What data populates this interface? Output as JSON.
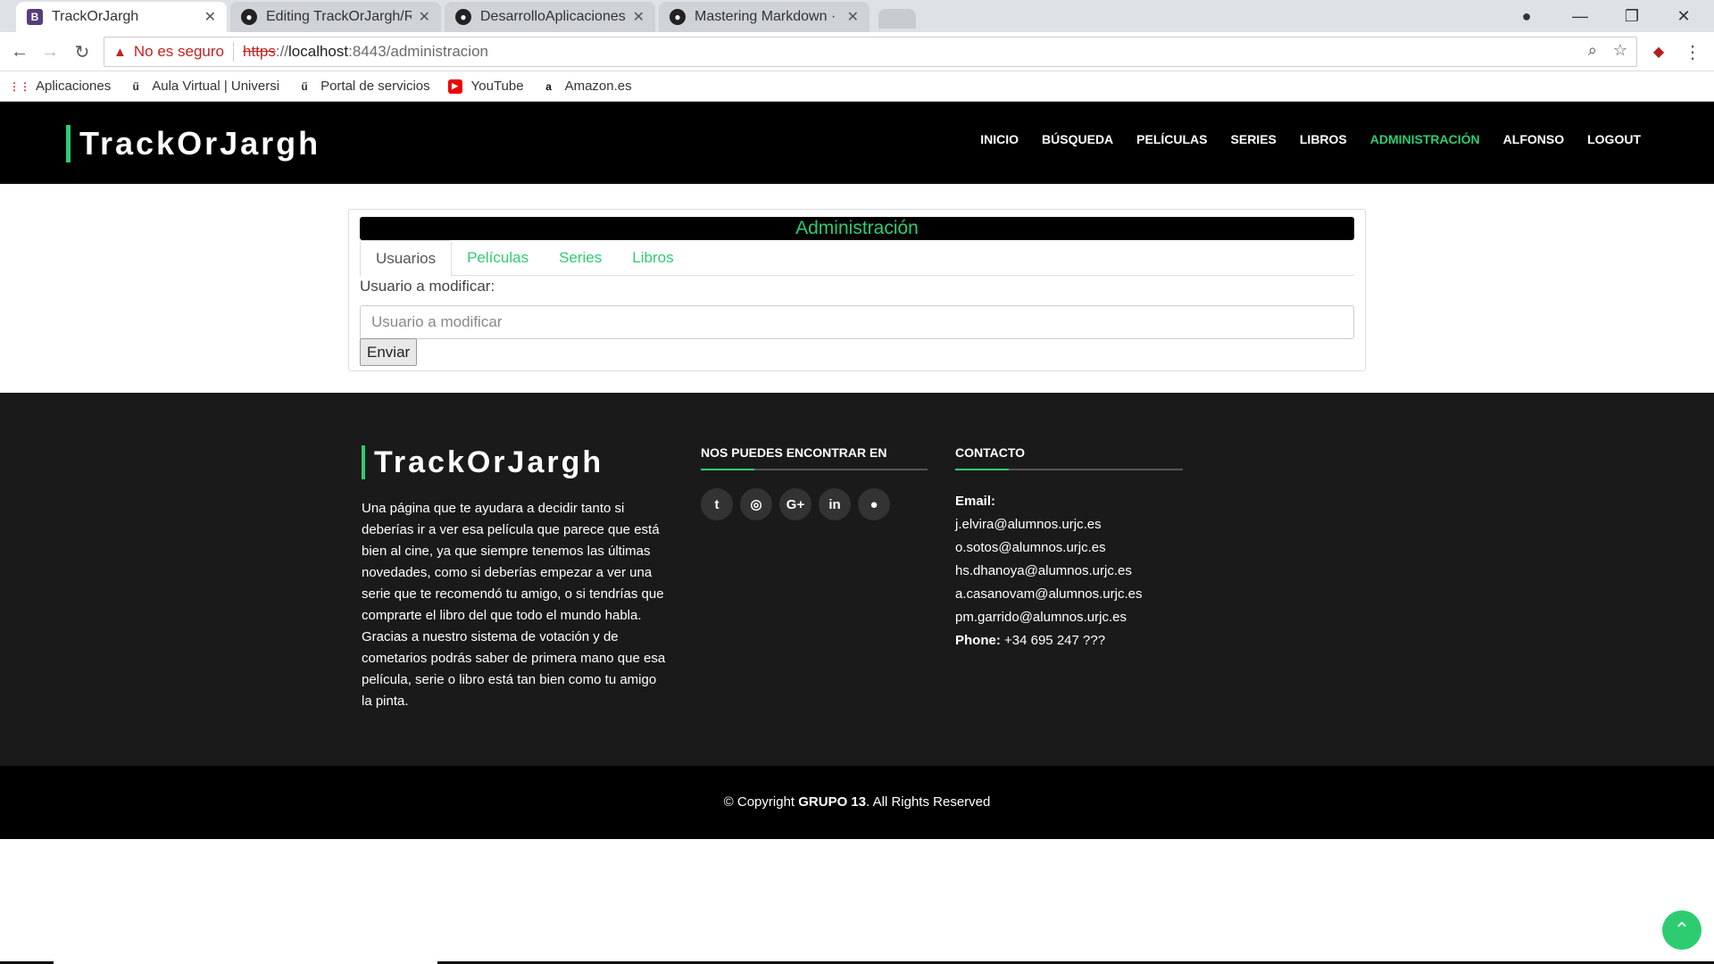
{
  "browser": {
    "tabs": [
      {
        "title": "TrackOrJargh",
        "icon": "bootstrap-icon",
        "active": true
      },
      {
        "title": "Editing TrackOrJargh/RE",
        "icon": "github-icon",
        "active": false
      },
      {
        "title": "DesarrolloAplicacionesW",
        "icon": "github-icon",
        "active": false
      },
      {
        "title": "Mastering Markdown · G",
        "icon": "github-icon",
        "active": false
      }
    ],
    "security_label": "No es seguro",
    "url_scheme": "https",
    "url_sep": "://",
    "url_host": "localhost",
    "url_path": ":8443/administracion",
    "bookmarks": [
      {
        "label": "Aplicaciones",
        "icon": "apps-grid-icon"
      },
      {
        "label": "Aula Virtual | Universi",
        "icon": "urjc-icon"
      },
      {
        "label": "Portal de servicios",
        "icon": "urjc-icon"
      },
      {
        "label": "YouTube",
        "icon": "youtube-icon"
      },
      {
        "label": "Amazon.es",
        "icon": "amazon-icon"
      }
    ]
  },
  "site": {
    "brand": "TrackOrJargh",
    "nav": [
      {
        "label": "INICIO",
        "active": false
      },
      {
        "label": "BÚSQUEDA",
        "active": false
      },
      {
        "label": "PELÍCULAS",
        "active": false
      },
      {
        "label": "SERIES",
        "active": false
      },
      {
        "label": "LIBROS",
        "active": false
      },
      {
        "label": "ADMINISTRACIÓN",
        "active": true
      },
      {
        "label": "ALFONSO",
        "active": false
      },
      {
        "label": "LOGOUT",
        "active": false
      }
    ],
    "accent_color": "#2ecc71"
  },
  "admin": {
    "title": "Administración",
    "tabs": [
      {
        "label": "Usuarios",
        "active": true
      },
      {
        "label": "Películas",
        "active": false
      },
      {
        "label": "Series",
        "active": false
      },
      {
        "label": "Libros",
        "active": false
      }
    ],
    "field_label": "Usuario a modificar:",
    "field_placeholder": "Usuario a modificar",
    "submit_label": "Enviar"
  },
  "footer": {
    "brand": "TrackOrJargh",
    "description": "Una página que te ayudara a decidir tanto si deberías ir a ver esa película que parece que está bien al cine, ya que siempre tenemos las últimas novedades, como si deberías empezar a ver una serie que te recomendó tu amigo, o si tendrías que comprarte el libro del que todo el mundo habla. Gracias a nuestro sistema de votación y de cometarios podrás saber de primera mano que esa película, serie o libro está tan bien como tu amigo la pinta.",
    "social_title": "NOS PUEDES ENCONTRAR EN",
    "socials": [
      "twitter-icon",
      "instagram-icon",
      "google-plus-icon",
      "linkedin-icon",
      "github-icon"
    ],
    "contact_title": "CONTACTO",
    "email_label": "Email:",
    "emails": [
      "j.elvira@alumnos.urjc.es",
      "o.sotos@alumnos.urjc.es",
      "hs.dhanoya@alumnos.urjc.es",
      "a.casanovam@alumnos.urjc.es",
      "pm.garrido@alumnos.urjc.es"
    ],
    "phone_label": "Phone:",
    "phone": "+34 695 247 ???",
    "copyright_prefix": "© Copyright",
    "copyright_group": "GRUPO 13",
    "copyright_suffix": ". All Rights Reserved"
  }
}
